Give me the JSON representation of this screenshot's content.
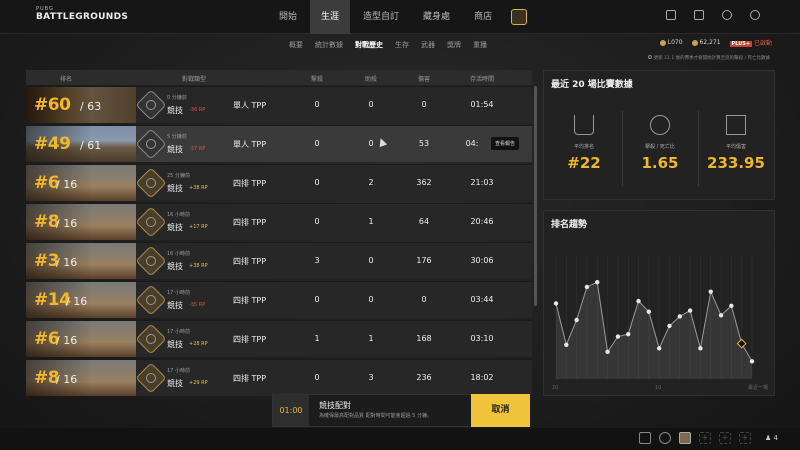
{
  "logo": {
    "line1": "PUBG",
    "line2": "BATTLEGROUNDS"
  },
  "main_nav": [
    "開始",
    "生涯",
    "造型自訂",
    "藏身處",
    "商店"
  ],
  "sub_nav": [
    "概要",
    "統計數據",
    "對戰歷史",
    "生存",
    "武器",
    "獎牌",
    "重播"
  ],
  "currency": {
    "g_coin": "L070",
    "bp": "62,271",
    "plus_badge": "PLUS+",
    "plus_status": "已啟動"
  },
  "notice": "更新 11.1 後的賽季才要開始計算至您的擊殺 / 死亡比數據",
  "table": {
    "headers": [
      "排名",
      "對戰類型",
      "擊殺",
      "助殺",
      "傷害",
      "存活時間"
    ],
    "rows": [
      {
        "place": "#60",
        "total": "/ 63",
        "time": "0 分鐘前",
        "mode": "競技",
        "rp": "-36 RP",
        "type": "單人 TPP",
        "kills": "0",
        "assists": "0",
        "damage": "0",
        "survival": "01:54"
      },
      {
        "place": "#49",
        "total": "/ 61",
        "time": "5 分鐘前",
        "mode": "競技",
        "rp": "-37 RP",
        "type": "單人 TPP",
        "kills": "0",
        "assists": "0",
        "damage": "53",
        "survival": "04:"
      },
      {
        "place": "#6",
        "total": "/ 16",
        "time": "25 分鐘前",
        "mode": "競技",
        "rp": "+38 RP",
        "type": "四排 TPP",
        "kills": "0",
        "assists": "2",
        "damage": "362",
        "survival": "21:03"
      },
      {
        "place": "#8",
        "total": "/ 16",
        "time": "16 小時前",
        "mode": "競技",
        "rp": "+17 RP",
        "type": "四排 TPP",
        "kills": "0",
        "assists": "1",
        "damage": "64",
        "survival": "20:46"
      },
      {
        "place": "#3",
        "total": "/ 16",
        "time": "16 小時前",
        "mode": "競技",
        "rp": "+38 RP",
        "type": "四排 TPP",
        "kills": "3",
        "assists": "0",
        "damage": "176",
        "survival": "30:06"
      },
      {
        "place": "#14",
        "total": "/ 16",
        "time": "17 小時前",
        "mode": "競技",
        "rp": "-35 RP",
        "type": "四排 TPP",
        "kills": "0",
        "assists": "0",
        "damage": "0",
        "survival": "03:44"
      },
      {
        "place": "#6",
        "total": "/ 16",
        "time": "17 小時前",
        "mode": "競技",
        "rp": "+28 RP",
        "type": "四排 TPP",
        "kills": "1",
        "assists": "1",
        "damage": "168",
        "survival": "03:10"
      },
      {
        "place": "#8",
        "total": "/ 16",
        "time": "17 小時前",
        "mode": "競技",
        "rp": "+29 RP",
        "type": "四排 TPP",
        "kills": "0",
        "assists": "3",
        "damage": "236",
        "survival": "18:02"
      }
    ],
    "tooltip": "查看報告"
  },
  "stats_panel": {
    "title": "最近 20 場比賽數據",
    "items": [
      {
        "label": "平均排名",
        "value": "#22",
        "icon": "podium-icon"
      },
      {
        "label": "擊殺 / 死亡比",
        "value": "1.65",
        "icon": "crosshair-icon"
      },
      {
        "label": "平均傷害",
        "value": "233.95",
        "icon": "damage-icon"
      }
    ]
  },
  "trend_panel": {
    "title": "排名趨勢",
    "x_labels": [
      "20",
      "10",
      "最近一場"
    ]
  },
  "chart_data": {
    "type": "line",
    "title": "排名趨勢",
    "x": [
      1,
      2,
      3,
      4,
      5,
      6,
      7,
      8,
      9,
      10,
      11,
      12,
      13,
      14,
      15,
      16,
      17,
      18,
      19,
      20
    ],
    "values": [
      0.64,
      0.29,
      0.5,
      0.78,
      0.82,
      0.23,
      0.36,
      0.38,
      0.66,
      0.57,
      0.26,
      0.45,
      0.53,
      0.58,
      0.26,
      0.74,
      0.54,
      0.62,
      0.3,
      0.15
    ],
    "ylim": [
      0,
      1
    ],
    "latest_marker": true,
    "colors": {
      "line": "#9a9a9a",
      "point": "#e6e6e6",
      "latest": "#f0b72a"
    }
  },
  "match_bar": {
    "timer": "01:00",
    "title": "競技配對",
    "desc": "為確保最高配對品質 配對時間可能會超過 5 分鐘。",
    "cancel": "取消"
  },
  "party": {
    "count": "4"
  }
}
